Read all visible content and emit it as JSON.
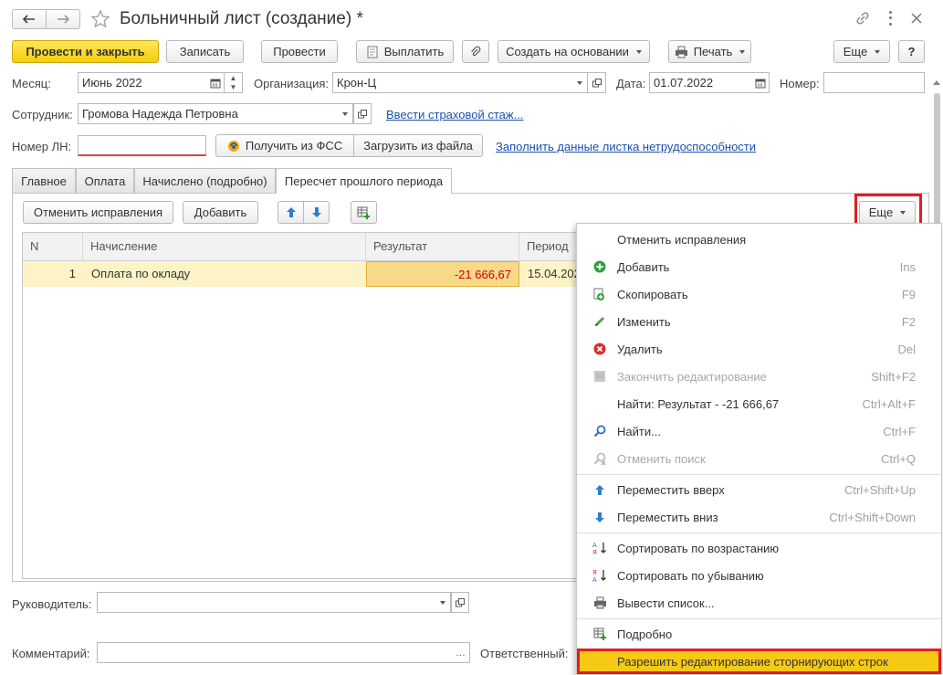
{
  "window": {
    "title": "Больничный лист (создание) *"
  },
  "toolbar": {
    "post_close": "Провести и закрыть",
    "save": "Записать",
    "post": "Провести",
    "pay": "Выплатить",
    "create_based": "Создать на основании",
    "print": "Печать",
    "more": "Еще",
    "help": "?"
  },
  "form": {
    "month_label": "Месяц:",
    "month_value": "Июнь 2022",
    "org_label": "Организация:",
    "org_value": "Крон-Ц",
    "date_label": "Дата:",
    "date_value": "01.07.2022",
    "number_label": "Номер:",
    "number_value": "",
    "employee_label": "Сотрудник:",
    "employee_value": "Громова Надежда Петровна",
    "insurance_link": "Ввести страховой стаж...",
    "ln_label": "Номер ЛН:",
    "ln_value": "",
    "get_fss": "Получить из ФСС",
    "load_file": "Загрузить из файла",
    "fill_link": "Заполнить данные листка нетрудоспособности"
  },
  "tabs": [
    {
      "label": "Главное"
    },
    {
      "label": "Оплата"
    },
    {
      "label": "Начислено (подробно)"
    },
    {
      "label": "Пересчет прошлого периода"
    }
  ],
  "tab_toolbar": {
    "cancel_fix": "Отменить исправления",
    "add": "Добавить",
    "more": "Еще"
  },
  "table": {
    "columns": [
      "N",
      "Начисление",
      "Результат",
      "Период"
    ],
    "rows": [
      {
        "n": "1",
        "accrual": "Оплата по окладу",
        "result": "-21 666,67",
        "period": "15.04.202"
      }
    ]
  },
  "footer": {
    "manager_label": "Руководитель:",
    "manager_value": "",
    "comment_label": "Комментарий:",
    "comment_value": "",
    "responsible_label": "Ответственный:"
  },
  "menu": {
    "items": [
      {
        "label": "Отменить исправления",
        "shortcut": "",
        "icon": "none"
      },
      {
        "label": "Добавить",
        "shortcut": "Ins",
        "icon": "add-icon"
      },
      {
        "label": "Скопировать",
        "shortcut": "F9",
        "icon": "copy-icon"
      },
      {
        "label": "Изменить",
        "shortcut": "F2",
        "icon": "pencil-icon"
      },
      {
        "label": "Удалить",
        "shortcut": "Del",
        "icon": "delete-icon"
      },
      {
        "label": "Закончить редактирование",
        "shortcut": "Shift+F2",
        "icon": "end-edit-icon"
      },
      {
        "label": "Найти: Результат - -21 666,67",
        "shortcut": "Ctrl+Alt+F",
        "icon": "none"
      },
      {
        "label": "Найти...",
        "shortcut": "Ctrl+F",
        "icon": "search-icon"
      },
      {
        "label": "Отменить поиск",
        "shortcut": "Ctrl+Q",
        "icon": "cancel-search-icon"
      },
      {
        "label": "Переместить вверх",
        "shortcut": "Ctrl+Shift+Up",
        "icon": "arrow-up-icon"
      },
      {
        "label": "Переместить вниз",
        "shortcut": "Ctrl+Shift+Down",
        "icon": "arrow-down-icon"
      },
      {
        "label": "Сортировать по возрастанию",
        "shortcut": "",
        "icon": "sort-asc-icon"
      },
      {
        "label": "Сортировать по убыванию",
        "shortcut": "",
        "icon": "sort-desc-icon"
      },
      {
        "label": "Вывести список...",
        "shortcut": "",
        "icon": "list-icon"
      },
      {
        "label": "Подробно",
        "shortcut": "",
        "icon": "detail-icon"
      },
      {
        "label": "Разрешить редактирование сторнирующих строк",
        "shortcut": "",
        "icon": "none"
      }
    ]
  },
  "colors": {
    "primary_button": "#f5cf0b",
    "highlight_border": "#e01e1e",
    "selected_row": "#fdf3c6",
    "link": "#1a4fae",
    "negative_value": "#d00000"
  }
}
